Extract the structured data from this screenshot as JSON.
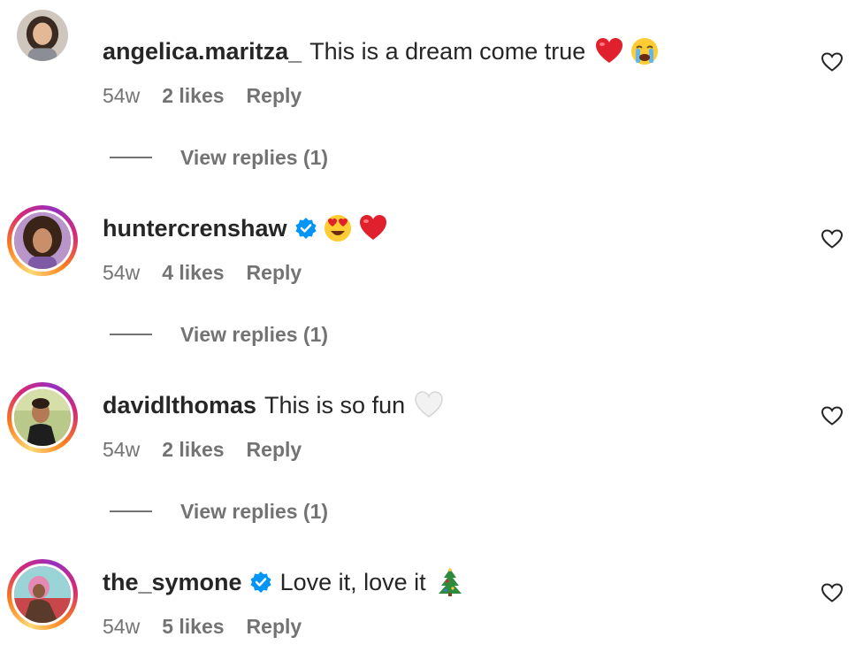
{
  "comments": [
    {
      "username": "angelica.maritza_",
      "verified": false,
      "text": "This is a dream come true",
      "emojis": [
        "red-heart-emoji",
        "loudly-crying-face-emoji"
      ],
      "age": "54w",
      "likes": "2 likes",
      "reply": "Reply",
      "view_replies": "View replies (1)"
    },
    {
      "username": "huntercrenshaw",
      "verified": true,
      "text": "",
      "emojis": [
        "heart-eyes-emoji",
        "red-heart-emoji"
      ],
      "age": "54w",
      "likes": "4 likes",
      "reply": "Reply",
      "view_replies": "View replies (1)"
    },
    {
      "username": "davidlthomas",
      "verified": false,
      "text": "This is so fun",
      "emojis": [
        "white-heart-emoji"
      ],
      "age": "54w",
      "likes": "2 likes",
      "reply": "Reply",
      "view_replies": "View replies (1)"
    },
    {
      "username": "the_symone",
      "verified": true,
      "text": "Love it, love it",
      "emojis": [
        "christmas-tree-emoji"
      ],
      "age": "54w",
      "likes": "5 likes",
      "reply": "Reply"
    }
  ],
  "colors": {
    "text": "#262626",
    "secondary": "#737373",
    "verified": "#0095f6",
    "story_ring": [
      "#feda75",
      "#fa7e1e",
      "#d62976",
      "#962fbf"
    ]
  }
}
